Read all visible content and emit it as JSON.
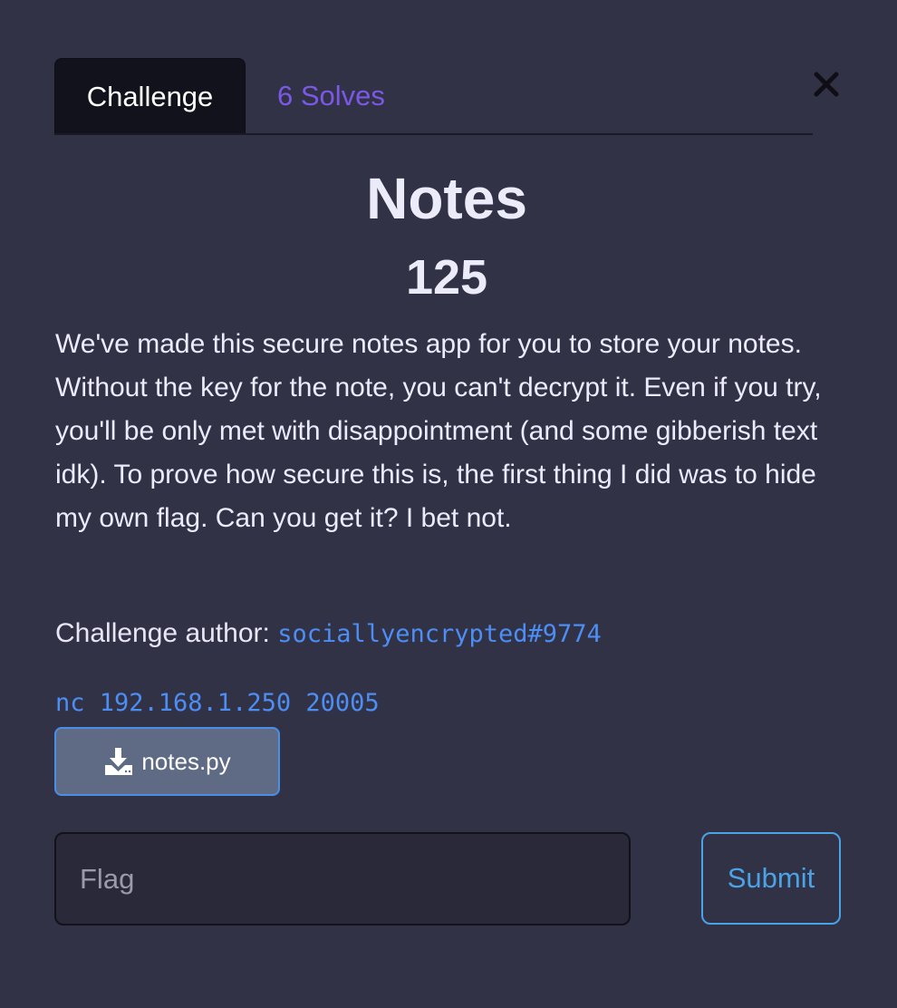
{
  "tabs": {
    "challenge_label": "Challenge",
    "solves_label": "6 Solves"
  },
  "close_icon": "close-icon",
  "challenge": {
    "name": "Notes",
    "points": "125",
    "description": "We've made this secure notes app for you to store your notes. Without the key for the note, you can't decrypt it. Even if you try, you'll be only met with disappointment (and some gibberish text idk). To prove how secure this is, the first thing I did was to hide my own flag. Can you get it? I bet not.",
    "author_label": "Challenge author:",
    "author_handle": "sociallyencrypted#9774",
    "connection": "nc 192.168.1.250 20005"
  },
  "file": {
    "icon": "download-icon",
    "name": "notes.py"
  },
  "flag_form": {
    "placeholder": "Flag",
    "value": "",
    "submit_label": "Submit"
  },
  "colors": {
    "background": "#323247",
    "active_tab": "#12121c",
    "solves_accent": "#7b59e6",
    "link": "#4c8ef3",
    "submit": "#4aa3e6"
  }
}
